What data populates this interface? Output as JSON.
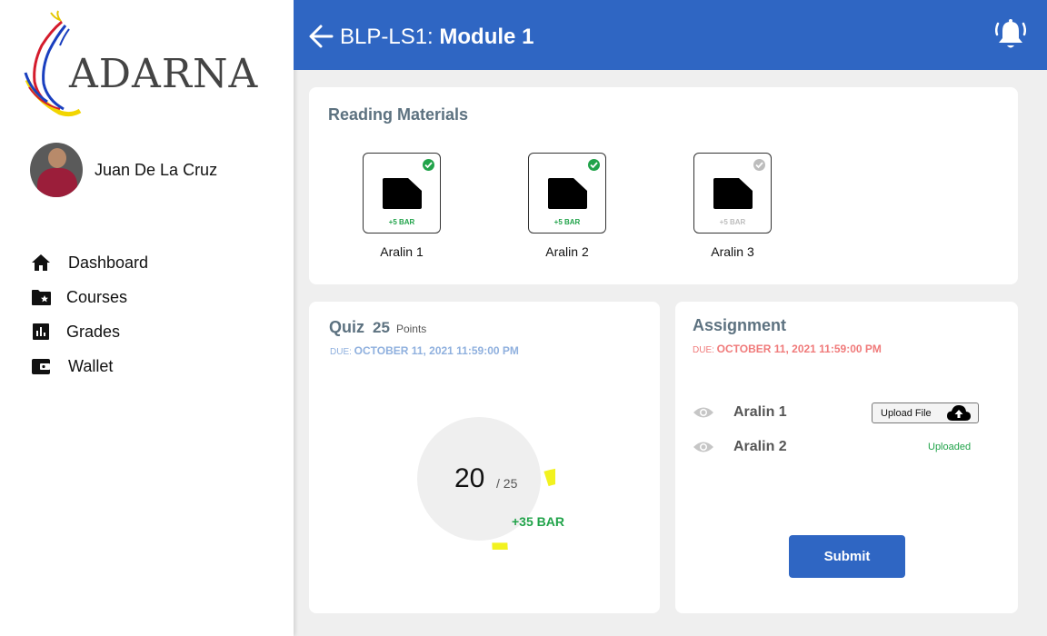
{
  "brand": {
    "logo_text": "ADARNA"
  },
  "user": {
    "name": "Juan De La Cruz"
  },
  "nav": {
    "items": [
      {
        "label": "Dashboard",
        "icon": "home-icon"
      },
      {
        "label": "Courses",
        "icon": "folder-star-icon"
      },
      {
        "label": "Grades",
        "icon": "bar-chart-icon"
      },
      {
        "label": "Wallet",
        "icon": "wallet-icon"
      }
    ]
  },
  "header": {
    "prefix": "BLP-LS1: ",
    "title": "Module 1",
    "accent": "#2f66c3"
  },
  "reading": {
    "title": "Reading Materials",
    "items": [
      {
        "name": "Aralin 1",
        "bonus": "+5 BAR",
        "completed": true
      },
      {
        "name": "Aralin 2",
        "bonus": "+5 BAR",
        "completed": true
      },
      {
        "name": "Aralin 3",
        "bonus": "+5 BAR",
        "completed": false
      }
    ]
  },
  "quiz": {
    "title": "Quiz",
    "points": "25",
    "points_label": "Points",
    "due_prefix": "DUE: ",
    "due_date": "OCTOBER 11, 2021 11:59:00 PM",
    "score": "20",
    "total": "/ 25",
    "score_fraction": 0.8,
    "bonus": "+35 BAR"
  },
  "assignment": {
    "title": "Assignment",
    "due_prefix": "DUE: ",
    "due_date": "OCTOBER 11, 2021 11:59:00 PM",
    "items": [
      {
        "name": "Aralin 1",
        "action": "Upload File"
      },
      {
        "name": "Aralin 2",
        "status": "Uploaded"
      }
    ],
    "submit_label": "Submit"
  }
}
